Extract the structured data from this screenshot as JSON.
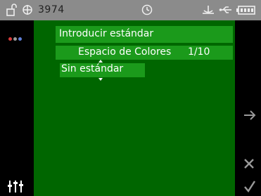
{
  "status_bar": {
    "value": "3974",
    "icons": [
      "lock-icon",
      "globe-icon",
      "clock-icon",
      "antenna-icon",
      "usb-icon",
      "battery-icon"
    ]
  },
  "left_panel": {
    "dot_colors": [
      "#d83c3c",
      "#9a9a9a",
      "#5f7fd8"
    ],
    "icons": [
      "dots-menu-icon",
      "sliders-icon"
    ]
  },
  "right_panel": {
    "icons": [
      "arrow-right-icon",
      "close-icon",
      "check-icon"
    ]
  },
  "main": {
    "title": "Introducir estándar",
    "color_space_label": "Espacio de Colores",
    "color_space_count": "1/10",
    "standard_value": "Sin estándar"
  },
  "colors": {
    "background": "#006600",
    "field": "#1b9a1b",
    "status_bar": "#8b8b8b"
  }
}
